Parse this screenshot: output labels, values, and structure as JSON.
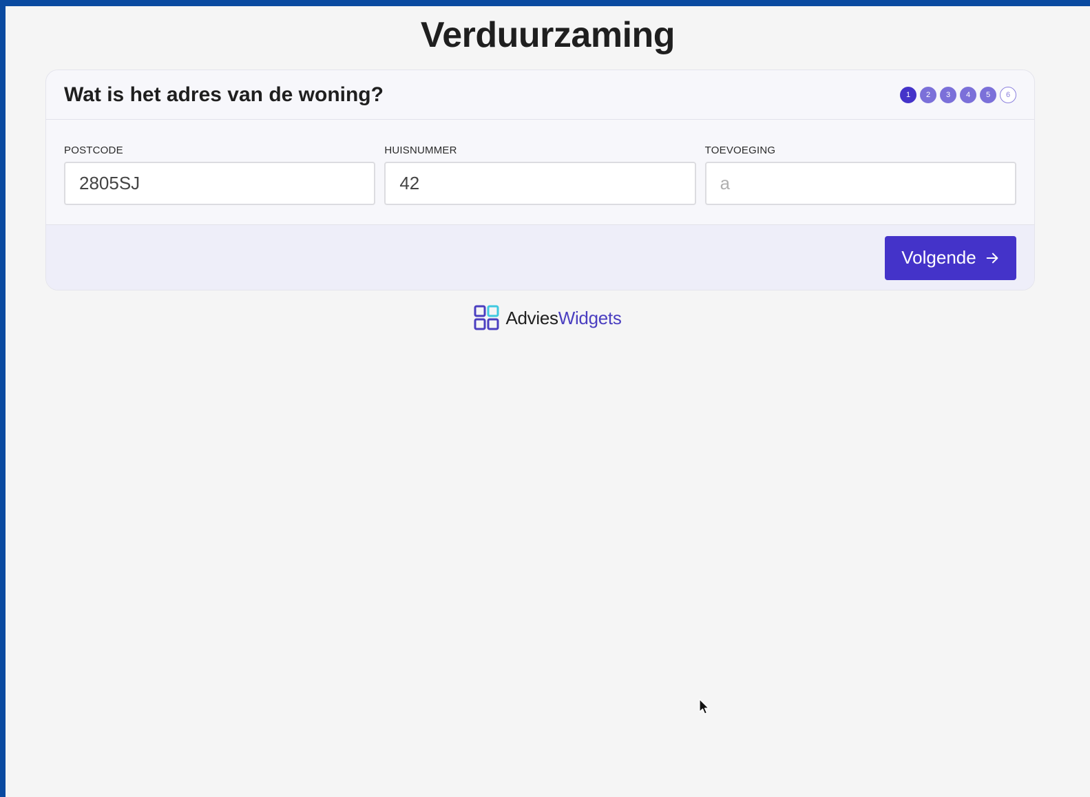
{
  "page": {
    "title": "Verduurzaming"
  },
  "card": {
    "question": "Wat is het adres van de woning?",
    "steps": {
      "items": [
        "1",
        "2",
        "3",
        "4",
        "5",
        "6"
      ],
      "current": 1
    },
    "fields": {
      "postcode": {
        "label": "POSTCODE",
        "value": "2805SJ",
        "placeholder": ""
      },
      "huisnummer": {
        "label": "HUISNUMMER",
        "value": "42",
        "placeholder": ""
      },
      "toevoeging": {
        "label": "TOEVOEGING",
        "value": "",
        "placeholder": "a"
      }
    },
    "next_button": {
      "label": "Volgende",
      "icon": "arrow-right-icon"
    }
  },
  "brand": {
    "part1": "Advies",
    "part2": "Widgets",
    "icon": "grid-logo-icon"
  },
  "colors": {
    "accent": "#4433c9",
    "step_done": "#7b70d9",
    "frame": "#0a4aa0",
    "logo_cyan": "#3fc9e0"
  }
}
